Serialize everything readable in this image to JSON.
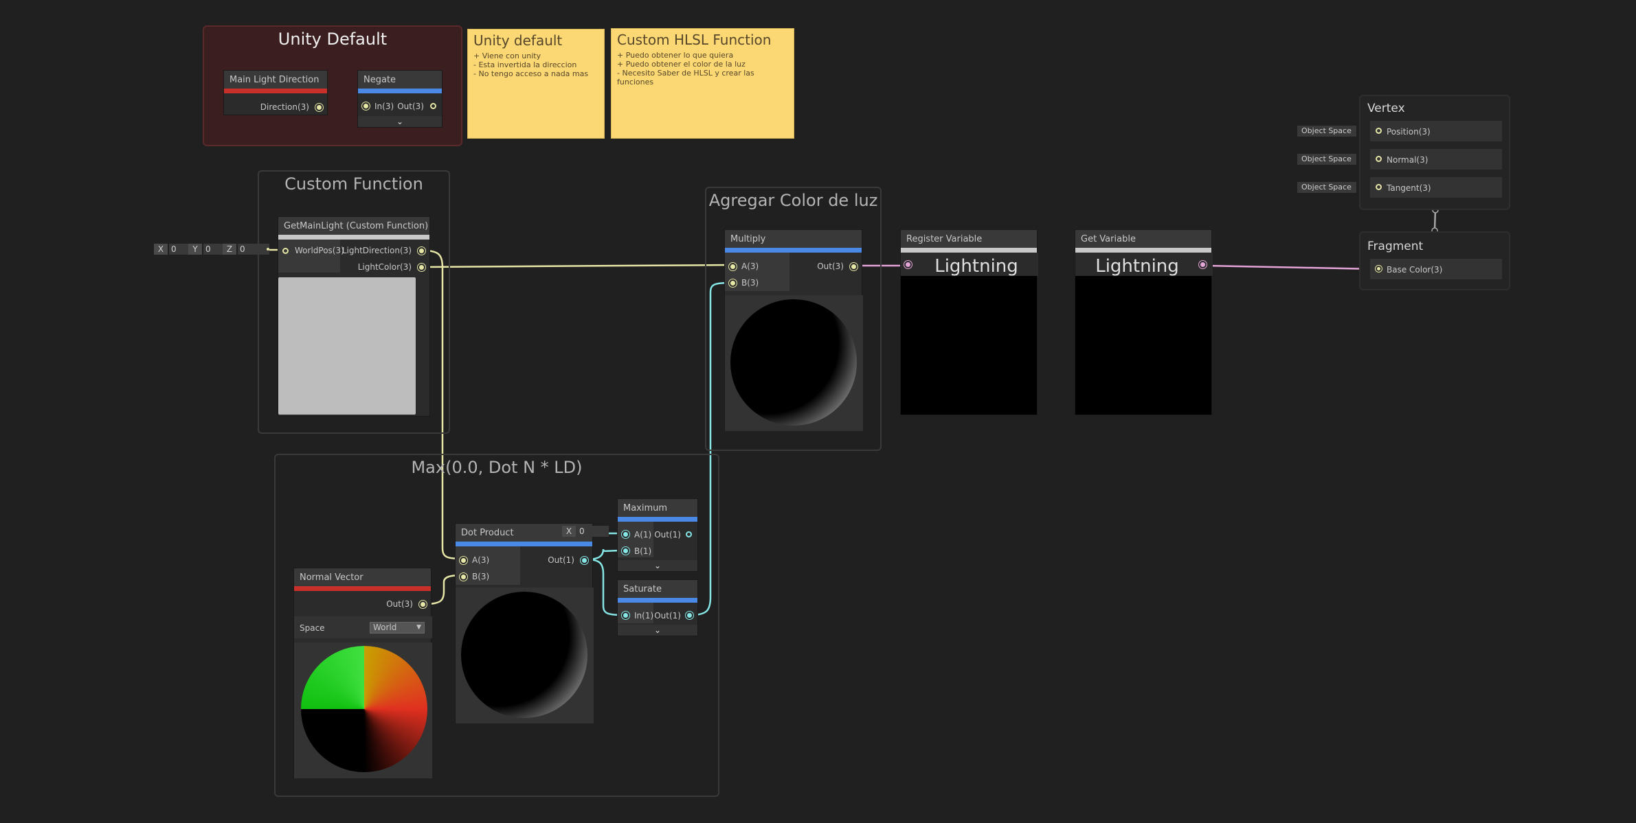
{
  "groups": {
    "unity_default": "Unity Default",
    "custom_function": "Custom Function",
    "max_dot": "Max(0.0, Dot N * LD)",
    "agregar_color": "Agregar Color de luz"
  },
  "sticky_notes": [
    {
      "title": "Unity default",
      "body": "+ Viene con unity\n- Esta invertida la direccion\n- No tengo acceso a nada mas"
    },
    {
      "title": "Custom HLSL Function",
      "body": "+ Puedo obtener lo que quiera\n+ Puedo obtener el color de la luz\n- Necesito Saber de HLSL y crear las funciones"
    }
  ],
  "nodes": {
    "main_light_direction": {
      "title": "Main Light Direction",
      "out": "Direction(3)"
    },
    "negate": {
      "title": "Negate",
      "in": "In(3)",
      "out": "Out(3)"
    },
    "get_main_light": {
      "title": "GetMainLight (Custom Function)",
      "in": "WorldPos(3)",
      "out1": "LightDirection(3)",
      "out2": "LightColor(3)"
    },
    "vector_input": {
      "x_label": "X",
      "x_val": "0",
      "y_label": "Y",
      "y_val": "0",
      "z_label": "Z",
      "z_val": "0"
    },
    "multiply": {
      "title": "Multiply",
      "in_a": "A(3)",
      "in_b": "B(3)",
      "out": "Out(3)"
    },
    "register_variable": {
      "title": "Register Variable",
      "value": "Lightning"
    },
    "get_variable": {
      "title": "Get Variable",
      "value": "Lightning"
    },
    "normal_vector": {
      "title": "Normal Vector",
      "out": "Out(3)",
      "space_label": "Space",
      "space_value": "World"
    },
    "dot_product": {
      "title": "Dot Product",
      "in_a": "A(3)",
      "in_b": "B(3)",
      "out": "Out(1)"
    },
    "max_x_input": {
      "label": "X",
      "value": "0"
    },
    "maximum": {
      "title": "Maximum",
      "in_a": "A(1)",
      "in_b": "B(1)",
      "out": "Out(1)"
    },
    "saturate": {
      "title": "Saturate",
      "in": "In(1)",
      "out": "Out(1)"
    }
  },
  "master": {
    "vertex_title": "Vertex",
    "vertex_ports": [
      {
        "space": "Object Space",
        "label": "Position(3)"
      },
      {
        "space": "Object Space",
        "label": "Normal(3)"
      },
      {
        "space": "Object Space",
        "label": "Tangent(3)"
      }
    ],
    "fragment_title": "Fragment",
    "fragment_port": "Base Color(3)"
  },
  "colors": {
    "canvas": "#202020",
    "wire_vector3": "#e6e6a6",
    "wire_float": "#86e6e6",
    "wire_color": "#e4a4d8",
    "header_math": "#4a8ae6",
    "header_input": "#c8302a",
    "sticky": "#fbd874"
  }
}
